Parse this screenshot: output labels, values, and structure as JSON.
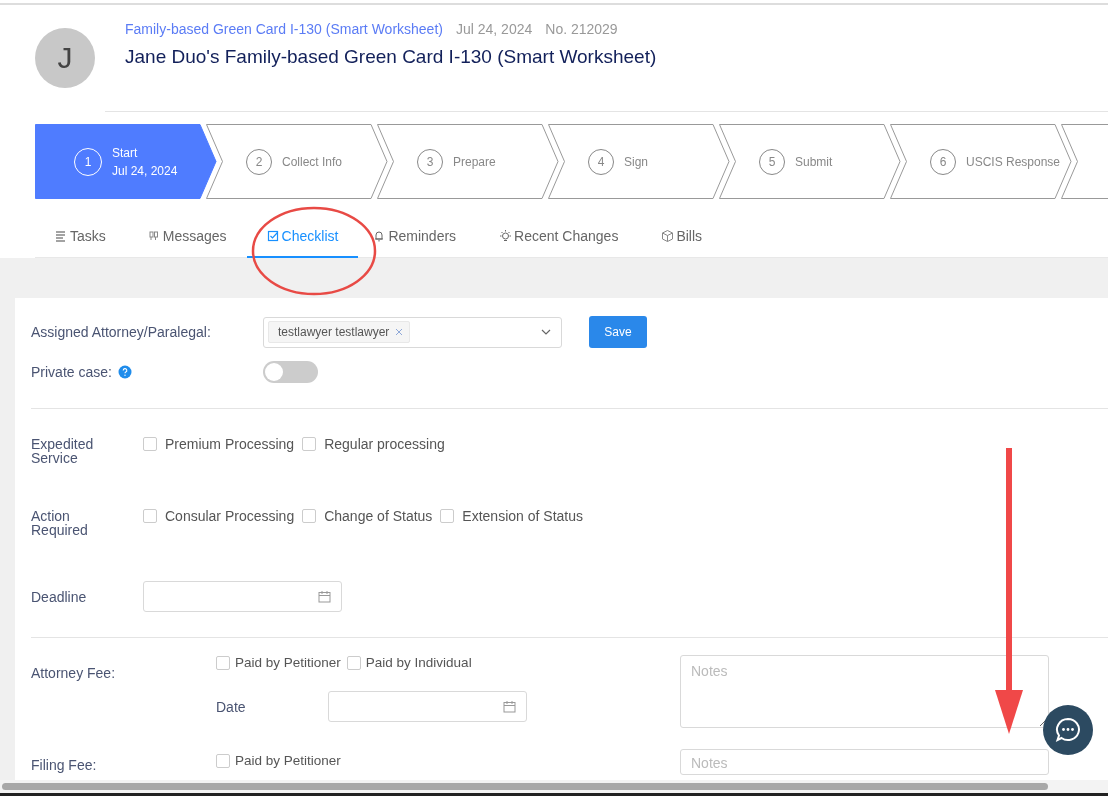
{
  "header": {
    "avatar_letter": "J",
    "case_type": "Family-based Green Card I-130 (Smart Worksheet)",
    "date": "Jul 24, 2024",
    "number": "No. 212029",
    "title": "Jane Duo's Family-based Green Card I-130 (Smart Worksheet)"
  },
  "steps": [
    {
      "kind": "step",
      "number": "1",
      "label": "Start",
      "sublabel": "Jul 24, 2024",
      "selected": true
    },
    {
      "kind": "step",
      "number": "2",
      "label": "Collect Info",
      "selected": false
    },
    {
      "kind": "step",
      "number": "3",
      "label": "Prepare",
      "selected": false
    },
    {
      "kind": "step",
      "number": "4",
      "label": "Sign",
      "selected": false
    },
    {
      "kind": "step",
      "number": "5",
      "label": "Submit",
      "selected": false
    },
    {
      "kind": "step",
      "number": "6",
      "label": "USCIS Response",
      "selected": false
    },
    {
      "kind": "cut-off",
      "selected": false
    }
  ],
  "tabs": [
    {
      "label": "Tasks",
      "selected": false
    },
    {
      "label": "Messages",
      "selected": false
    },
    {
      "label": "Checklist",
      "selected": true
    },
    {
      "label": "Reminders",
      "selected": false
    },
    {
      "label": "Recent Changes",
      "selected": false
    },
    {
      "label": "Bills",
      "selected": false
    }
  ],
  "assignment": {
    "label": "Assigned Attorney/Paralegal:",
    "tags": [
      "testlawyer testlawyer"
    ],
    "save": "Save"
  },
  "private_case": {
    "label": "Private case:",
    "on": false
  },
  "checkbox_groups": [
    {
      "label": "Expedited Service",
      "options": [
        {
          "label": "Premium Processing",
          "checked": false
        },
        {
          "label": "Regular processing",
          "checked": false
        }
      ]
    },
    {
      "label": "Action Required",
      "options": [
        {
          "label": "Consular Processing",
          "checked": false
        },
        {
          "label": "Change of Status",
          "checked": false
        },
        {
          "label": "Extension of Status",
          "checked": false
        }
      ]
    }
  ],
  "deadline": {
    "label": "Deadline"
  },
  "fees": [
    {
      "label": "Attorney Fee:",
      "options": [
        {
          "label": "Paid by Petitioner",
          "checked": false
        },
        {
          "label": "Paid by Individual",
          "checked": false
        }
      ],
      "date_label": "Date",
      "notes_placeholder": "Notes"
    },
    {
      "label": "Filing Fee:",
      "options": [
        {
          "label": "Paid by Petitioner",
          "checked": false
        }
      ],
      "notes_placeholder": "Notes"
    }
  ]
}
